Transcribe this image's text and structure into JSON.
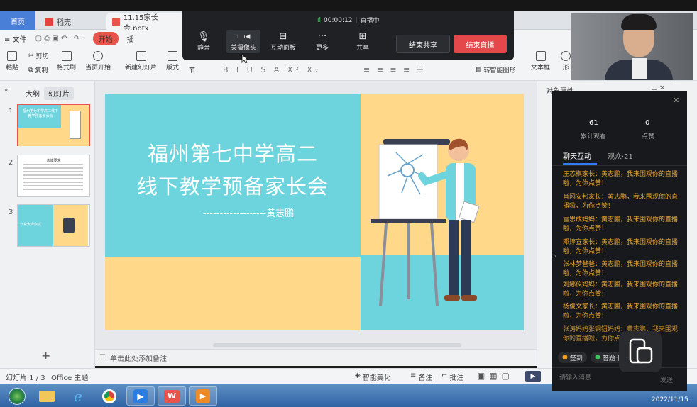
{
  "tabs": {
    "home": "首页",
    "daoke": "稻壳",
    "file": "11.15家长会.pptx"
  },
  "menu": {
    "file": "≡ 文件",
    "start": "开始",
    "insert": "插"
  },
  "ribbon": {
    "paste": "粘贴",
    "cut": "剪切",
    "copy": "复制",
    "format_painter": "格式刷",
    "play_from": "当页开始",
    "new_slide": "新建幻灯片",
    "layout": "版式",
    "section": "节",
    "smart_graphic": "转智能图形",
    "textbox": "文本框",
    "shape": "形"
  },
  "leftpane": {
    "tab_outline": "大纲",
    "tab_slides": "幻灯片",
    "add": "+"
  },
  "thumbs": [
    {
      "num": "1",
      "title": "福州第七中学高二线下教学预备家长会"
    },
    {
      "num": "2",
      "title": "总体要求"
    },
    {
      "num": "3",
      "title": "日常大课会议"
    }
  ],
  "slide": {
    "title_line1": "福州第七中学高二",
    "title_line2": "线下教学预备家长会",
    "author": "-------------------黄志鹏"
  },
  "notes": {
    "placeholder": "单击此处添加备注"
  },
  "statusbar": {
    "slide_pos": "幻灯片 1 / 3",
    "theme": "Office 主题",
    "smart_beautify": "智能美化",
    "notes": "备注",
    "comments": "批注"
  },
  "rightpane": {
    "title": "对象属性"
  },
  "meeting": {
    "timer": "00:00:12",
    "status": "直播中",
    "mute": "静音",
    "camera": "关摄像头",
    "board": "互动面板",
    "more": "更多",
    "share": "共享",
    "end_share": "结束共享",
    "end_live": "结束直播"
  },
  "chat": {
    "total_views": "61",
    "total_views_label": "累计观看",
    "likes": "0",
    "likes_label": "点赞",
    "tab_chat": "聊天互动",
    "tab_audience": "观众·21",
    "messages": [
      "庄芯棋家长：黄志鹏，我来围观你的直播啦，为你点赞！",
      "肖冈安邦家长：黄志鹏，我来围观你的直播啦，为你点赞！",
      "雷思成妈妈：黄志鹏，我来围观你的直播啦，为你点赞！",
      "邓婷宣家长：黄志鹏，我来围观你的直播啦，为你点赞！",
      "张林梦爸爸：黄志鹏，我来围观你的直播啦，为你点赞！",
      "刘娜仪妈妈：黄志鹏，我来围观你的直播啦，为你点赞！",
      "杨俊文家长：黄志鹏，我来围观你的直播啦，为你点赞！",
      "张涛妈妈张钢钮妈妈：黄志鹏，我来围观你的直播啦，为你点"
    ],
    "signin": "签到",
    "question": "答题卡",
    "input_placeholder": "请输入消息",
    "send": "发送"
  },
  "taskbar": {
    "date": "2022/11/15"
  },
  "colors": {
    "slide_teal": "#6dd4dd",
    "slide_yellow": "#ffd88a",
    "accent_red": "#e8544b",
    "chat_orange": "#e9a630"
  }
}
